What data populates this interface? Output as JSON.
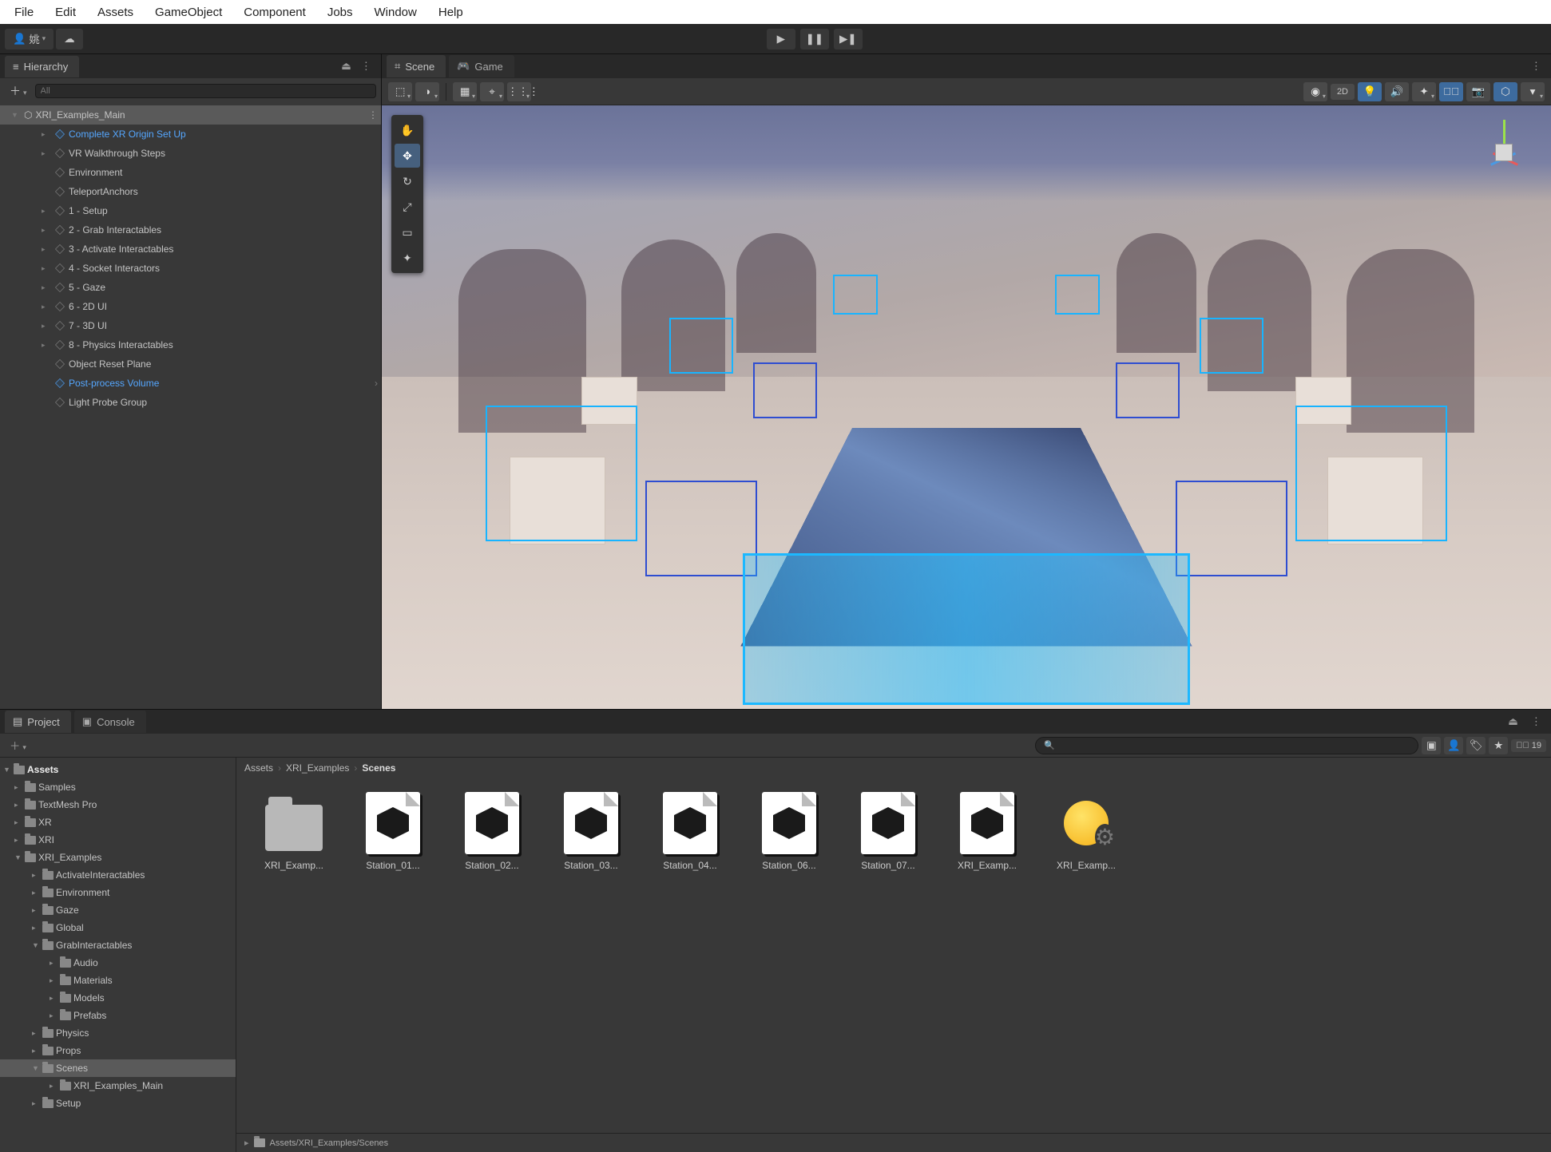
{
  "menubar": [
    "File",
    "Edit",
    "Assets",
    "GameObject",
    "Component",
    "Jobs",
    "Window",
    "Help"
  ],
  "toolbar": {
    "account": "姚"
  },
  "hierarchy": {
    "tab": "Hierarchy",
    "search_placeholder": "All",
    "scene": "XRI_Examples_Main",
    "items": [
      {
        "label": "Complete XR Origin Set Up",
        "selected": true,
        "blue": true,
        "expand": true
      },
      {
        "label": "VR Walkthrough Steps",
        "expand": true
      },
      {
        "label": "Environment",
        "expand": false
      },
      {
        "label": "TeleportAnchors",
        "expand": false
      },
      {
        "label": "1 - Setup",
        "expand": true
      },
      {
        "label": "2 - Grab Interactables",
        "expand": true
      },
      {
        "label": "3 - Activate Interactables",
        "expand": true
      },
      {
        "label": "4 - Socket Interactors",
        "expand": true
      },
      {
        "label": "5 - Gaze",
        "expand": true
      },
      {
        "label": "6 - 2D UI",
        "expand": true
      },
      {
        "label": "7 - 3D UI",
        "expand": true
      },
      {
        "label": "8 - Physics Interactables",
        "expand": true
      },
      {
        "label": "Object Reset Plane",
        "expand": false
      },
      {
        "label": "Post-process Volume",
        "selected": true,
        "blue": true,
        "expand": false,
        "chev": true
      },
      {
        "label": "Light Probe Group",
        "expand": false
      }
    ]
  },
  "scene": {
    "tabs": [
      {
        "label": "Scene",
        "active": true
      },
      {
        "label": "Game",
        "active": false
      }
    ],
    "mode2d": "2D"
  },
  "project": {
    "tabs": [
      {
        "label": "Project",
        "active": true
      },
      {
        "label": "Console",
        "active": false
      }
    ],
    "hidden_count": "19",
    "tree": {
      "root": "Assets",
      "items": [
        {
          "label": "Samples",
          "lvl": 1
        },
        {
          "label": "TextMesh Pro",
          "lvl": 1
        },
        {
          "label": "XR",
          "lvl": 1
        },
        {
          "label": "XRI",
          "lvl": 1
        },
        {
          "label": "XRI_Examples",
          "lvl": 1,
          "open": true
        },
        {
          "label": "ActivateInteractables",
          "lvl": 2
        },
        {
          "label": "Environment",
          "lvl": 2
        },
        {
          "label": "Gaze",
          "lvl": 2
        },
        {
          "label": "Global",
          "lvl": 2
        },
        {
          "label": "GrabInteractables",
          "lvl": 2,
          "open": true
        },
        {
          "label": "Audio",
          "lvl": 3
        },
        {
          "label": "Materials",
          "lvl": 3
        },
        {
          "label": "Models",
          "lvl": 3
        },
        {
          "label": "Prefabs",
          "lvl": 3
        },
        {
          "label": "Physics",
          "lvl": 2
        },
        {
          "label": "Props",
          "lvl": 2
        },
        {
          "label": "Scenes",
          "lvl": 2,
          "open": true,
          "sel": true
        },
        {
          "label": "XRI_Examples_Main",
          "lvl": 3
        },
        {
          "label": "Setup",
          "lvl": 2
        }
      ]
    },
    "breadcrumb": [
      "Assets",
      "XRI_Examples",
      "Scenes"
    ],
    "assets": [
      {
        "label": "XRI_Examp...",
        "kind": "folder"
      },
      {
        "label": "Station_01...",
        "kind": "unity"
      },
      {
        "label": "Station_02...",
        "kind": "unity"
      },
      {
        "label": "Station_03...",
        "kind": "unity"
      },
      {
        "label": "Station_04...",
        "kind": "unity"
      },
      {
        "label": "Station_06...",
        "kind": "unity"
      },
      {
        "label": "Station_07...",
        "kind": "unity"
      },
      {
        "label": "XRI_Examp...",
        "kind": "unity"
      },
      {
        "label": "XRI_Examp...",
        "kind": "light"
      }
    ],
    "footer_path": "Assets/XRI_Examples/Scenes"
  }
}
